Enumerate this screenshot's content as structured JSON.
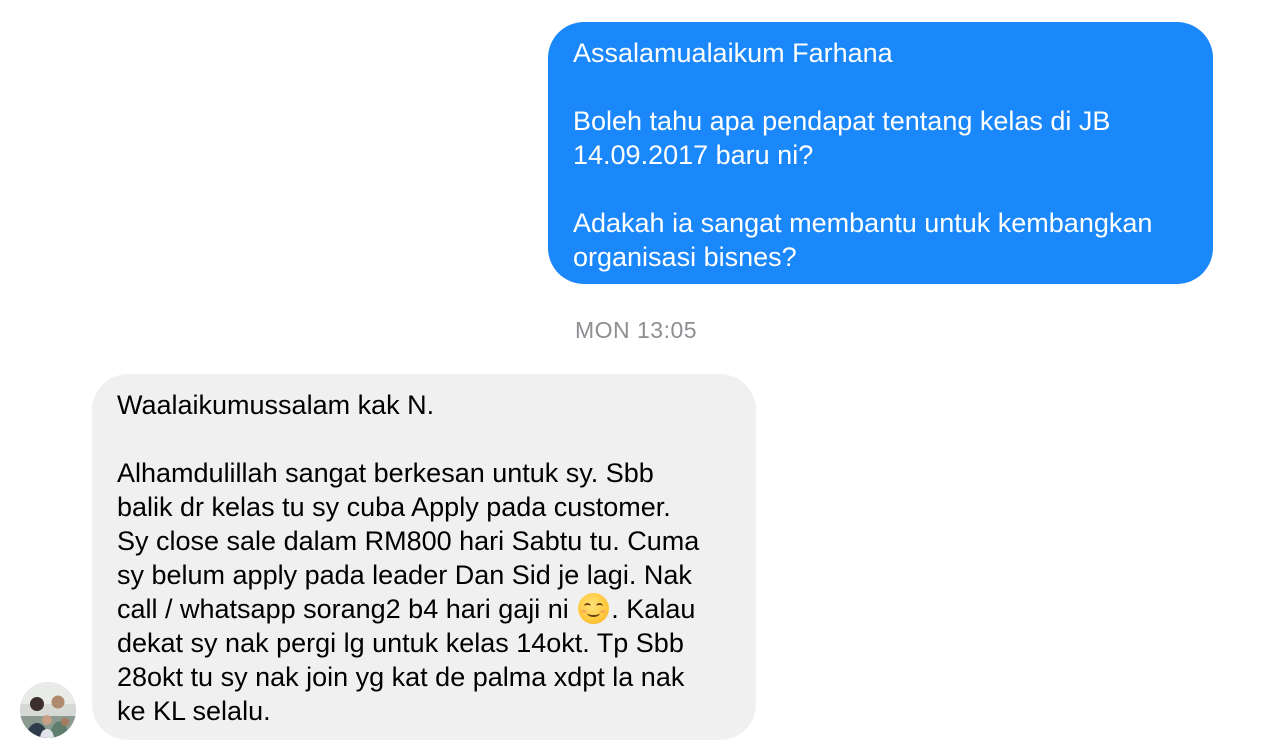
{
  "conversation": {
    "outgoing_message": {
      "lines": [
        "Assalamualaikum Farhana",
        "",
        "Boleh tahu apa pendapat tentang kelas di JB",
        "14.09.2017 baru ni?",
        "",
        "Adakah ia sangat membantu untuk kembangkan",
        "organisasi bisnes?"
      ]
    },
    "timestamp": "MON 13:05",
    "incoming_message": {
      "lines": [
        "Waalaikumussalam kak N.",
        "",
        "Alhamdulillah sangat berkesan untuk sy. Sbb",
        "balik dr kelas tu sy cuba Apply pada customer.",
        "Sy close sale dalam RM800 hari Sabtu tu. Cuma",
        "sy belum apply pada leader Dan Sid je lagi. Nak",
        "call / whatsapp sorang2 b4 hari gaji ni",
        ". Kalau",
        "dekat sy nak pergi lg untuk kelas 14okt. Tp Sbb",
        "28okt tu sy nak join yg kat de palma xdpt la nak",
        "ke KL selalu."
      ],
      "emoji_icon": "smiling-face-icon"
    },
    "sender_avatar_icon": "profile-photo-avatar"
  },
  "colors": {
    "outgoing_bubble": "#1a87fb",
    "incoming_bubble": "#f0f0f0",
    "timestamp_text": "#8e8e93"
  }
}
